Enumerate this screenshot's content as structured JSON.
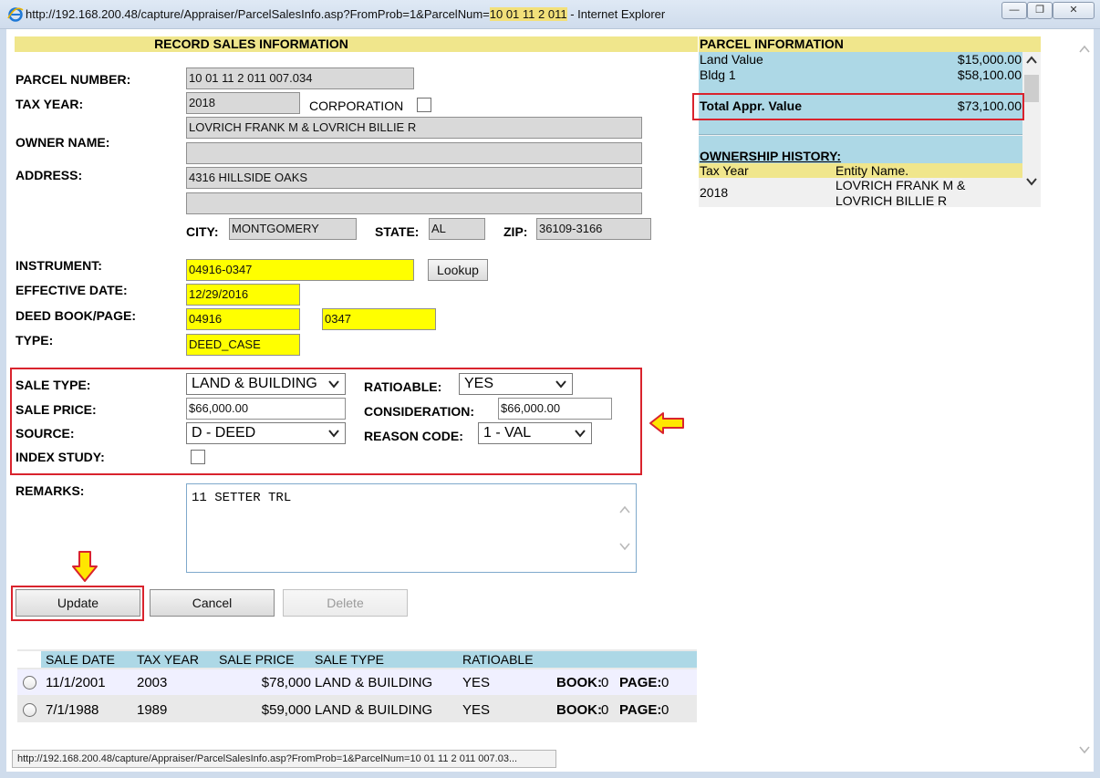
{
  "window": {
    "url_prefix": "http://192.168.200.48/capture/Appraiser/ParcelSalesInfo.asp?FromProb=1&ParcelNum=",
    "url_highlight": "10 01 11 2 011",
    "url_suffix": " - Internet Explorer",
    "minimize": "—",
    "restore": "❐",
    "close": "✕"
  },
  "record": {
    "heading": "RECORD SALES INFORMATION",
    "parcel_number_label": "PARCEL NUMBER:",
    "parcel_number": "10 01 11 2 011 007.034",
    "tax_year_label": "TAX YEAR:",
    "tax_year": "2018",
    "corporation_label": "CORPORATION",
    "owner_name_label": "OWNER NAME:",
    "owner_name_1": "LOVRICH FRANK M & LOVRICH BILLIE R",
    "owner_name_2": "",
    "address_label": "ADDRESS:",
    "address_1": "4316 HILLSIDE OAKS",
    "address_2": "",
    "city_label": "CITY:",
    "city": "MONTGOMERY",
    "state_label": "STATE:",
    "state": "AL",
    "zip_label": "ZIP:",
    "zip": "36109-3166",
    "instrument_label": "INSTRUMENT:",
    "instrument": "04916-0347",
    "lookup_label": "Lookup",
    "effective_date_label": "EFFECTIVE DATE:",
    "effective_date": "12/29/2016",
    "deed_book_page_label": "DEED BOOK/PAGE:",
    "deed_book": "04916",
    "deed_page": "0347",
    "type_label": "TYPE:",
    "type": "DEED_CASE"
  },
  "sale": {
    "sale_type_label": "SALE TYPE:",
    "sale_type": "LAND & BUILDING",
    "ratioable_label": "RATIOABLE:",
    "ratioable": "YES",
    "sale_price_label": "SALE PRICE:",
    "sale_price": "$66,000.00",
    "consideration_label": "CONSIDERATION:",
    "consideration": "$66,000.00",
    "source_label": "SOURCE:",
    "source": "D - DEED",
    "reason_code_label": "REASON CODE:",
    "reason_code": "1 - VAL",
    "index_study_label": "INDEX STUDY:",
    "remarks_label": "REMARKS:",
    "remarks": "11 SETTER TRL"
  },
  "buttons": {
    "update": "Update",
    "cancel": "Cancel",
    "delete": "Delete"
  },
  "parcel_info": {
    "heading": "PARCEL INFORMATION",
    "land_value_label": "Land Value",
    "land_value": "$15,000.00",
    "bldg_label": "Bldg 1",
    "bldg_value": "$58,100.00",
    "total_label": "Total Appr. Value",
    "total_value": "$73,100.00",
    "ownership_heading": "OWNERSHIP HISTORY:",
    "col_tax_year": "Tax Year",
    "col_entity": "Entity Name.",
    "row_year": "2018",
    "row_entity_1": "LOVRICH FRANK M &",
    "row_entity_2": "LOVRICH BILLIE R"
  },
  "sales_table": {
    "headers": [
      "SALE DATE",
      "TAX YEAR",
      "SALE PRICE",
      "SALE TYPE",
      "RATIOABLE"
    ],
    "rows": [
      {
        "sale_date": "11/1/2001",
        "tax_year": "2003",
        "sale_price": "$78,000",
        "sale_type": "LAND & BUILDING",
        "ratioable": "YES",
        "book_label": "BOOK:",
        "book": "0",
        "page_label": "PAGE:",
        "page": "0"
      },
      {
        "sale_date": "7/1/1988",
        "tax_year": "1989",
        "sale_price": "$59,000",
        "sale_type": "LAND & BUILDING",
        "ratioable": "YES",
        "book_label": "BOOK:",
        "book": "0",
        "page_label": "PAGE:",
        "page": "0"
      }
    ]
  },
  "status_bar": {
    "url": "http://192.168.200.48/capture/Appraiser/ParcelSalesInfo.asp?FromProb=1&ParcelNum=10 01 11 2 011 007.03..."
  },
  "colors": {
    "highlight_red": "#d9232d",
    "yellow_field": "#ffff00",
    "section_header": "#f0e68c",
    "panel_blue": "#add8e6",
    "arrow_fill": "#ffe600"
  }
}
